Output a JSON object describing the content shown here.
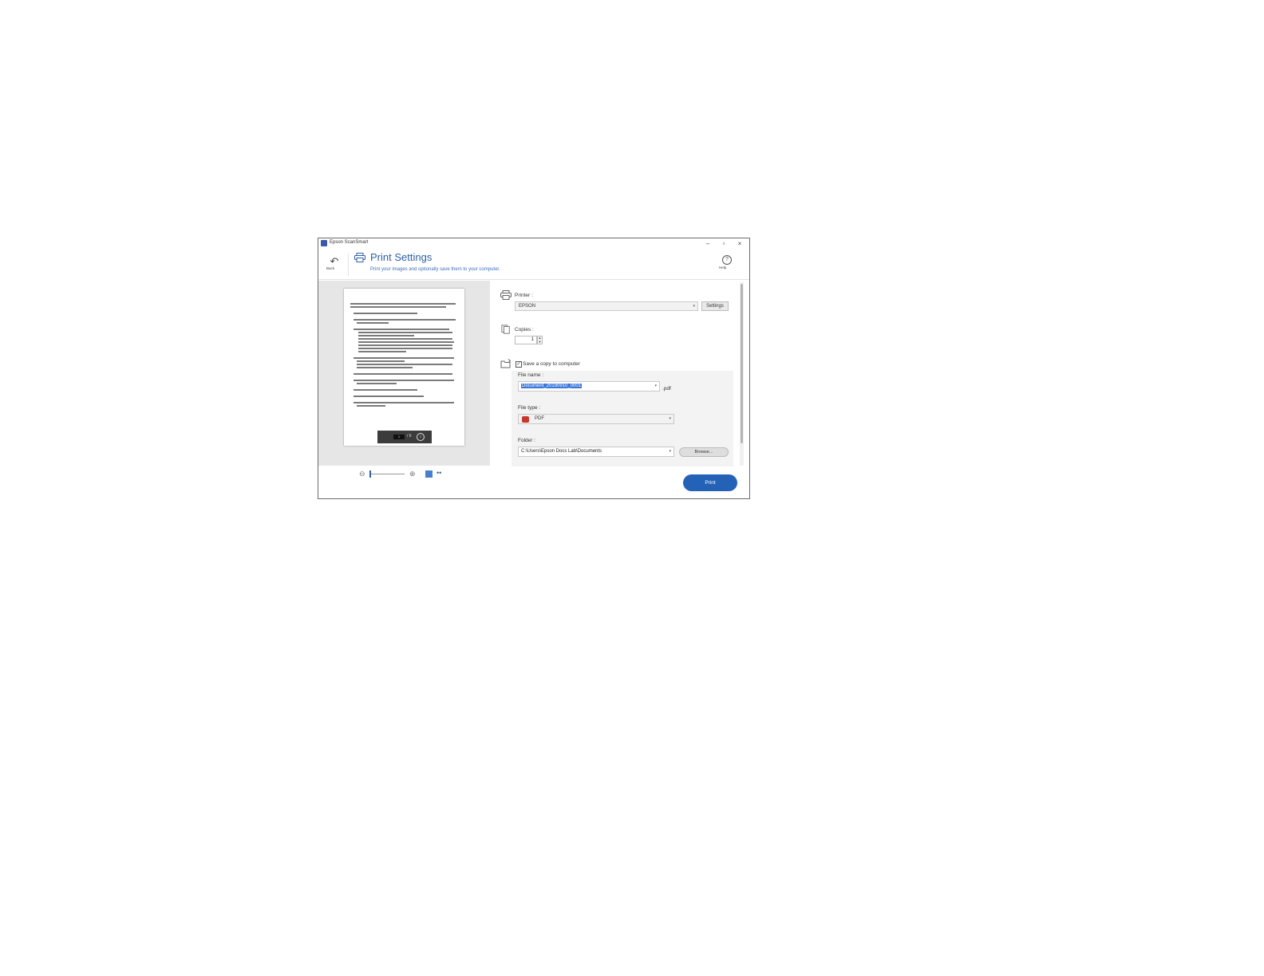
{
  "window": {
    "title": "Epson ScanSmart"
  },
  "header": {
    "back_label": "Back",
    "title": "Print Settings",
    "subtitle": "Print your images and optionally save them to your computer.",
    "help_label": "Help"
  },
  "preview": {
    "page_number": "1",
    "page_total": "/ 6"
  },
  "printer": {
    "label": "Printer :",
    "value": "EPSON",
    "settings_button": "Settings"
  },
  "copies": {
    "label": "Copies :",
    "value": "1"
  },
  "save_copy": {
    "label": "Save a copy to computer",
    "checked": true,
    "file_name_label": "File name :",
    "file_name_value": "Document_20190910_0001",
    "extension": ".pdf",
    "file_type_label": "File type :",
    "file_type_value": "PDF",
    "folder_label": "Folder :",
    "folder_value": "C:\\Users\\Epson Docs Lab\\Documents",
    "browse_button": "Browse..."
  },
  "actions": {
    "print_button": "Print"
  },
  "colors": {
    "accent": "#2462b8",
    "title_blue": "#2f5fa6"
  }
}
